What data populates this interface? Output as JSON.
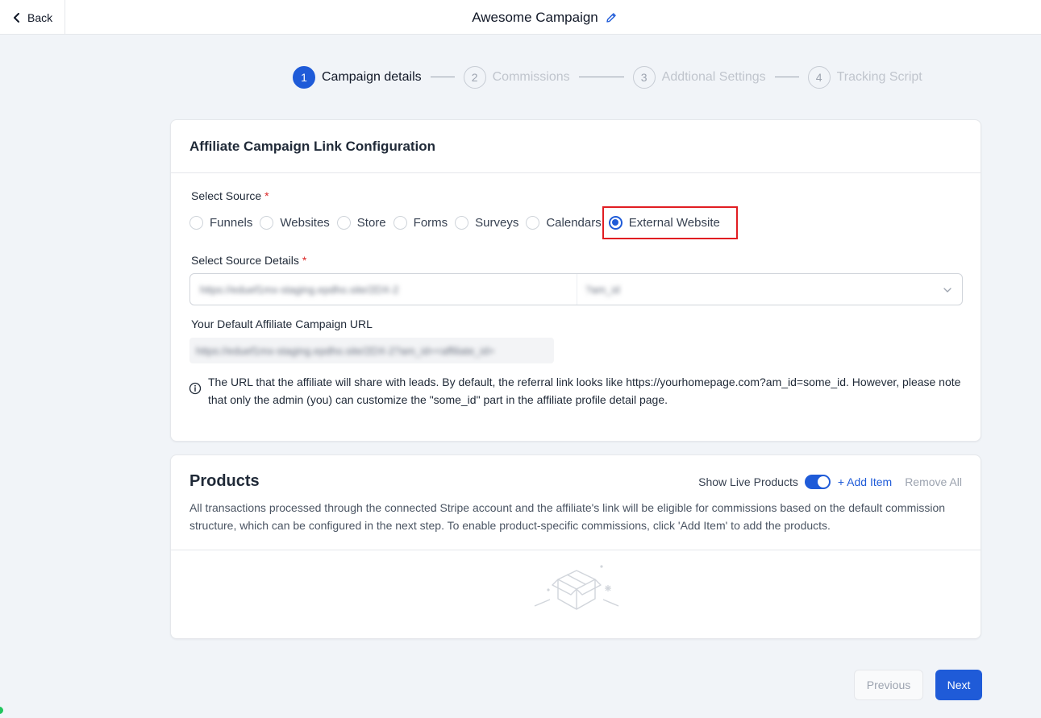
{
  "header": {
    "back_label": "Back",
    "title": "Awesome Campaign"
  },
  "stepper": {
    "steps": [
      {
        "num": "1",
        "label": "Campaign details",
        "active": true
      },
      {
        "num": "2",
        "label": "Commissions",
        "active": false
      },
      {
        "num": "3",
        "label": "Addtional Settings",
        "active": false
      },
      {
        "num": "4",
        "label": "Tracking Script",
        "active": false
      }
    ]
  },
  "link_config": {
    "heading": "Affiliate Campaign Link Configuration",
    "select_source_label": "Select Source",
    "required_mark": "*",
    "sources": [
      "Funnels",
      "Websites",
      "Store",
      "Forms",
      "Surveys",
      "Calendars",
      "External Website"
    ],
    "selected_source": "External Website",
    "source_details_label": "Select Source Details",
    "source_details_value": "https://eduef1mx-staging.epdho.site/2DX-2",
    "source_param_value": "?am_id",
    "default_url_label": "Your Default Affiliate Campaign URL",
    "default_url_value": "https://eduef1mx-staging.epdho.site/2DX-2?am_id=<affiliate_id>",
    "info_text": "The URL that the affiliate will share with leads. By default, the referral link looks like https://yourhomepage.com?am_id=some_id. However, please note that only the admin (you) can customize the \"some_id\" part in the affiliate profile detail page."
  },
  "products": {
    "heading": "Products",
    "show_live_label": "Show Live Products",
    "show_live_enabled": true,
    "add_item_label": "+ Add Item",
    "remove_all_label": "Remove All",
    "description": "All transactions processed through the connected Stripe account and the affiliate's link will be eligible for commissions based on the default commission structure, which can be configured in the next step. To enable product-specific commissions, click 'Add Item' to add the products."
  },
  "footer": {
    "previous_label": "Previous",
    "next_label": "Next"
  },
  "colors": {
    "primary": "#1f5bd8",
    "highlight": "#e11d22",
    "required": "#dc2626"
  }
}
